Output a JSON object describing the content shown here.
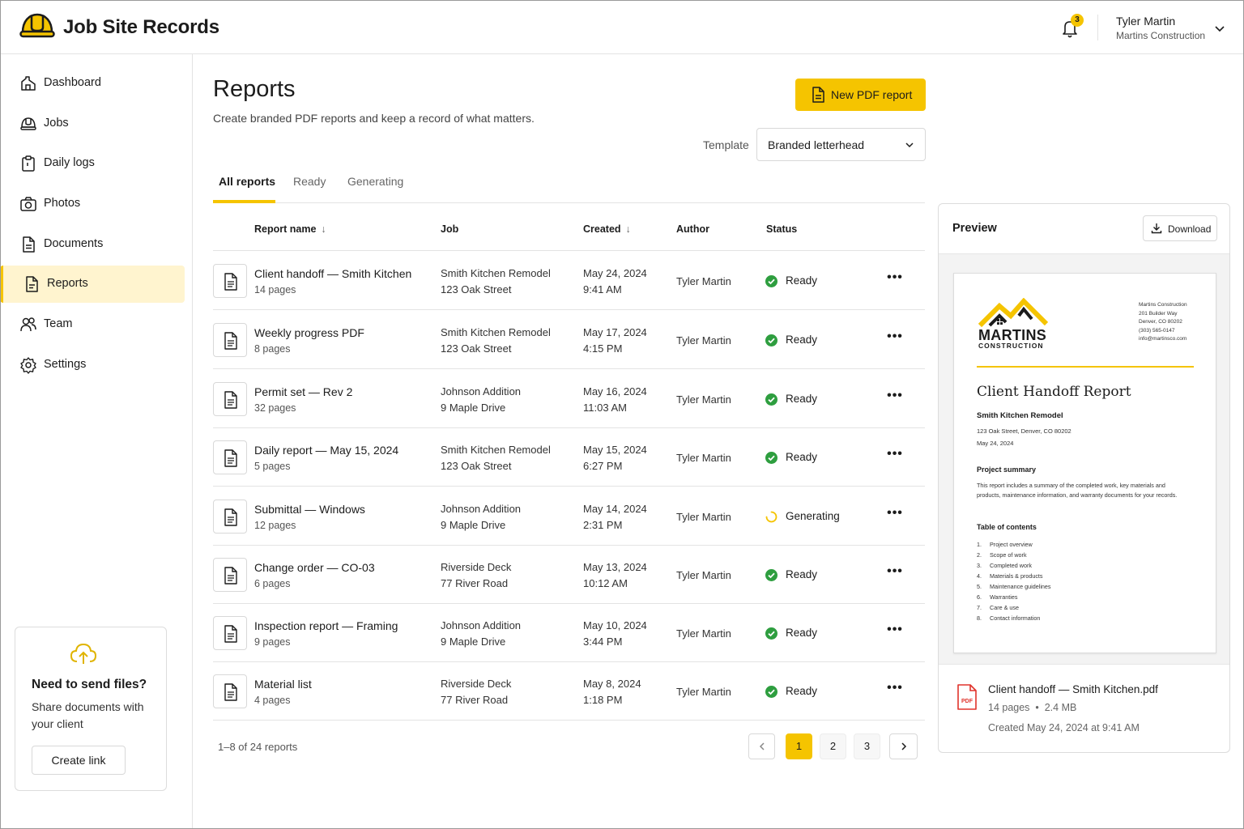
{
  "app": {
    "title": "Job Site Records"
  },
  "header": {
    "notifications_count": "3",
    "user_name": "Tyler Martin",
    "user_org": "Martins Construction"
  },
  "sidebar": {
    "items": [
      {
        "label": "Dashboard",
        "icon": "dashboard-icon"
      },
      {
        "label": "Jobs",
        "icon": "hardhat-icon"
      },
      {
        "label": "Daily logs",
        "icon": "clipboard-icon"
      },
      {
        "label": "Photos",
        "icon": "camera-icon"
      },
      {
        "label": "Documents",
        "icon": "document-icon"
      },
      {
        "label": "Reports",
        "icon": "report-icon",
        "active": true
      },
      {
        "label": "Team",
        "icon": "team-icon"
      },
      {
        "label": "Settings",
        "icon": "gear-icon"
      }
    ],
    "promo": {
      "title": "Need to send files?",
      "text": "Share documents with your client",
      "button": "Create link"
    }
  },
  "main": {
    "title": "Reports",
    "subtitle": "Create branded PDF reports and keep a record of what matters.",
    "new_button": "New PDF report",
    "template_label": "Template",
    "template_value": "Branded letterhead",
    "tabs": [
      {
        "label": "All reports"
      },
      {
        "label": "Ready"
      },
      {
        "label": "Generating"
      }
    ],
    "columns": {
      "name": "Report name",
      "job": "Job",
      "created": "Created",
      "author": "Author",
      "status": "Status"
    },
    "rows": [
      {
        "name": "Client handoff — Smith Kitchen",
        "pages": "14 pages",
        "job": "Smith Kitchen Remodel",
        "address": "123 Oak Street",
        "date": "May 24, 2024",
        "time": "9:41 AM",
        "author": "Tyler Martin",
        "status": "Ready"
      },
      {
        "name": "Weekly progress PDF",
        "pages": "8 pages",
        "job": "Smith Kitchen Remodel",
        "address": "123 Oak Street",
        "date": "May 17, 2024",
        "time": "4:15 PM",
        "author": "Tyler Martin",
        "status": "Ready"
      },
      {
        "name": "Permit set — Rev 2",
        "pages": "32 pages",
        "job": "Johnson Addition",
        "address": "9 Maple Drive",
        "date": "May 16, 2024",
        "time": "11:03 AM",
        "author": "Tyler Martin",
        "status": "Ready"
      },
      {
        "name": "Daily report — May 15, 2024",
        "pages": "5 pages",
        "job": "Smith Kitchen Remodel",
        "address": "123 Oak Street",
        "date": "May 15, 2024",
        "time": "6:27 PM",
        "author": "Tyler Martin",
        "status": "Ready"
      },
      {
        "name": "Submittal — Windows",
        "pages": "12 pages",
        "job": "Johnson Addition",
        "address": "9 Maple Drive",
        "date": "May 14, 2024",
        "time": "2:31 PM",
        "author": "Tyler Martin",
        "status": "Generating"
      },
      {
        "name": "Change order — CO-03",
        "pages": "6 pages",
        "job": "Riverside Deck",
        "address": "77 River Road",
        "date": "May 13, 2024",
        "time": "10:12 AM",
        "author": "Tyler Martin",
        "status": "Ready"
      },
      {
        "name": "Inspection report — Framing",
        "pages": "9 pages",
        "job": "Johnson Addition",
        "address": "9 Maple Drive",
        "date": "May 10, 2024",
        "time": "3:44 PM",
        "author": "Tyler Martin",
        "status": "Ready"
      },
      {
        "name": "Material list",
        "pages": "4 pages",
        "job": "Riverside Deck",
        "address": "77 River Road",
        "date": "May 8, 2024",
        "time": "1:18 PM",
        "author": "Tyler Martin",
        "status": "Ready"
      }
    ],
    "pagination": {
      "summary": "1–8 of 24 reports",
      "pages": [
        "1",
        "2",
        "3"
      ],
      "current": "1"
    }
  },
  "preview": {
    "title": "Preview",
    "download": "Download",
    "doc": {
      "brand_name": "MARTINS",
      "brand_sub": "CONSTRUCTION",
      "address_lines": [
        "Martins Construction",
        "201 Builder Way",
        "Denver, CO 80202",
        "(303) 565-0147",
        "info@martinsco.com"
      ],
      "heading": "Client Handoff Report",
      "project": "Smith Kitchen Remodel",
      "project_address": "123 Oak Street, Denver, CO 80202",
      "date": "May 24, 2024",
      "summary_title": "Project summary",
      "summary_text": "This report includes a summary of the completed work, key materials and products, maintenance information, and warranty documents for your records.",
      "toc_title": "Table of contents",
      "toc": [
        "Project overview",
        "Scope of work",
        "Completed work",
        "Materials & products",
        "Maintenance guidelines",
        "Warranties",
        "Care & use",
        "Contact information"
      ]
    },
    "file_name": "Client handoff — Smith Kitchen.pdf",
    "file_pages": "14 pages",
    "file_size": "2.4 MB",
    "file_created": "Created May 24, 2024 at 9:41 AM"
  },
  "colors": {
    "accent": "#f5c400",
    "success": "#2e9e3f",
    "text": "#1c1c1c",
    "pdf_red": "#e0332b"
  }
}
